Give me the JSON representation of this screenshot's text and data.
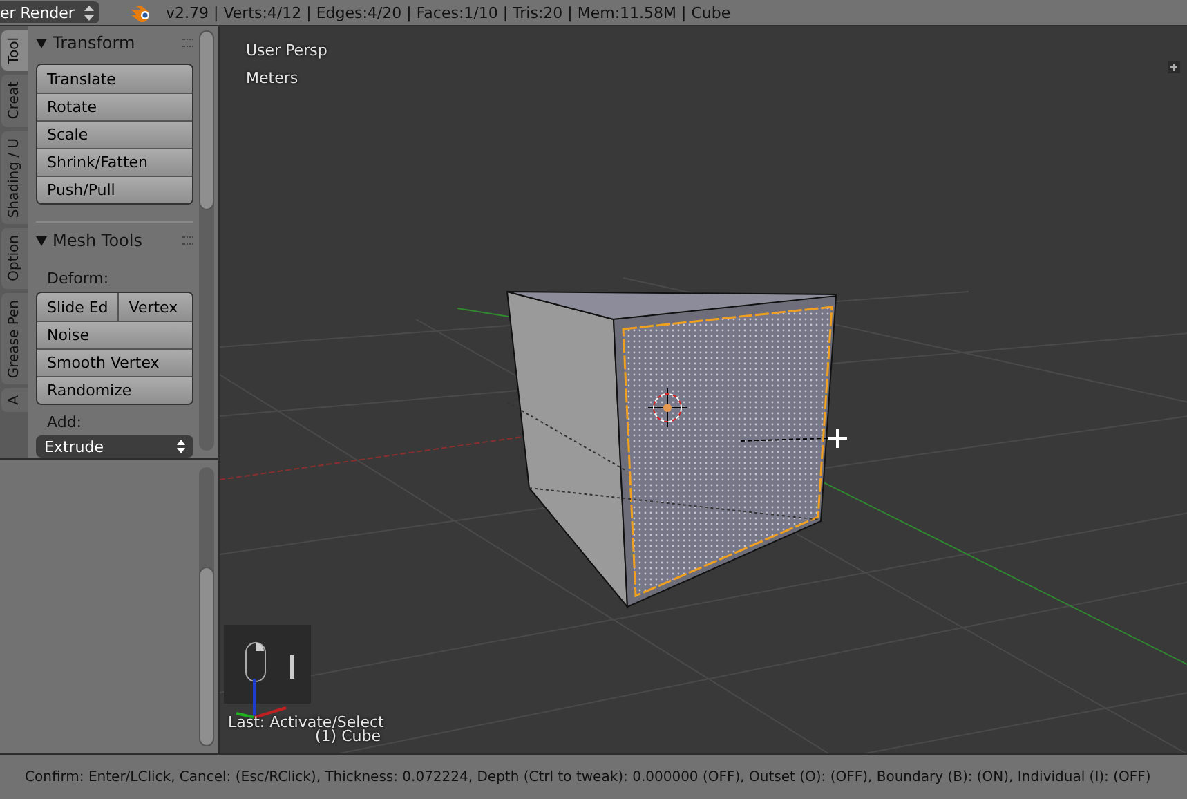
{
  "header": {
    "render_engine": "er Render",
    "info": "v2.79 | Verts:4/12 | Edges:4/20 | Faces:1/10 | Tris:20 | Mem:11.58M | Cube"
  },
  "tabs": [
    {
      "label": "Tool",
      "selected": true
    },
    {
      "label": "Creat",
      "selected": false
    },
    {
      "label": "Shading / U",
      "selected": false
    },
    {
      "label": "Option",
      "selected": false
    },
    {
      "label": "Grease Pen",
      "selected": false
    },
    {
      "label": "A",
      "selected": false
    }
  ],
  "panels": [
    {
      "title": "Transform",
      "expanded": true,
      "items": [
        {
          "kind": "buttons",
          "buttons": [
            [
              "Translate"
            ],
            [
              "Rotate"
            ],
            [
              "Scale"
            ],
            [
              "Shrink/Fatten"
            ],
            [
              "Push/Pull"
            ]
          ]
        }
      ]
    },
    {
      "title": "Mesh Tools",
      "expanded": true,
      "items": [
        {
          "kind": "label",
          "text": "Deform:"
        },
        {
          "kind": "buttons",
          "buttons": [
            [
              "Slide Ed",
              "Vertex"
            ],
            [
              "Noise"
            ],
            [
              "Smooth Vertex"
            ],
            [
              "Randomize"
            ]
          ]
        },
        {
          "kind": "label",
          "text": "Add:"
        },
        {
          "kind": "dropdown",
          "text": "Extrude"
        }
      ]
    }
  ],
  "viewport": {
    "view_name": "User Persp",
    "units": "Meters",
    "last_operator": "Last: Activate/Select",
    "object_name": "(1) Cube"
  },
  "status_bar": {
    "text": "Confirm: Enter/LClick, Cancel: (Esc/RClick), Thickness: 0.072224, Depth (Ctrl to tweak): 0.000000 (OFF), Outset (O): (OFF), Boundary (B): (ON), Individual (I): (OFF)"
  }
}
